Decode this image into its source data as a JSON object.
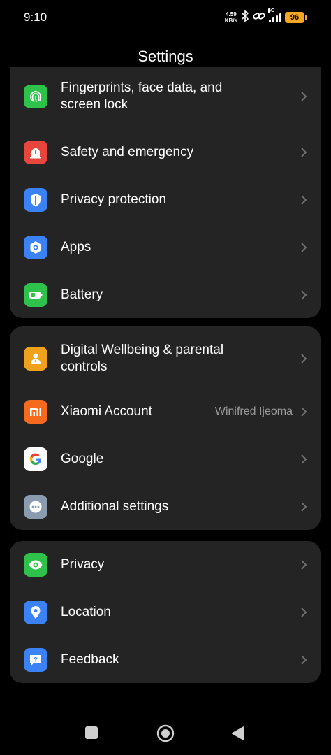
{
  "status": {
    "time": "9:10",
    "speed_value": "4.59",
    "speed_unit": "KB/s",
    "network": "4G",
    "battery": "96",
    "battery_color": "#f5a623"
  },
  "header": {
    "title": "Settings"
  },
  "groups": [
    {
      "items": [
        {
          "label": "Fingerprints, face data, and screen lock",
          "icon": "fingerprint-icon",
          "color": "#2fc24a"
        },
        {
          "label": "Safety and emergency",
          "icon": "emergency-icon",
          "color": "#e8453c"
        },
        {
          "label": "Privacy protection",
          "icon": "shield-icon",
          "color": "#3b82f6"
        },
        {
          "label": "Apps",
          "icon": "apps-gear-icon",
          "color": "#3b82f6"
        },
        {
          "label": "Battery",
          "icon": "battery-icon",
          "color": "#2fc24a"
        }
      ]
    },
    {
      "items": [
        {
          "label": "Digital Wellbeing & parental controls",
          "icon": "wellbeing-icon",
          "color": "#f0a21c"
        },
        {
          "label": "Xiaomi Account",
          "value": "Winifred Ijeoma",
          "icon": "xiaomi-mi-icon",
          "color": "#f56a1c"
        },
        {
          "label": "Google",
          "icon": "google-icon",
          "color": "#ffffff"
        },
        {
          "label": "Additional settings",
          "icon": "more-dots-icon",
          "color": "#8a9bb0"
        }
      ]
    },
    {
      "items": [
        {
          "label": "Privacy",
          "icon": "eye-icon",
          "color": "#2fc24a"
        },
        {
          "label": "Location",
          "icon": "location-pin-icon",
          "color": "#3b82f6"
        },
        {
          "label": "Feedback",
          "icon": "feedback-question-icon",
          "color": "#3b82f6"
        }
      ]
    }
  ],
  "navbar": {
    "buttons": [
      "recents-button",
      "home-button",
      "back-button"
    ]
  }
}
